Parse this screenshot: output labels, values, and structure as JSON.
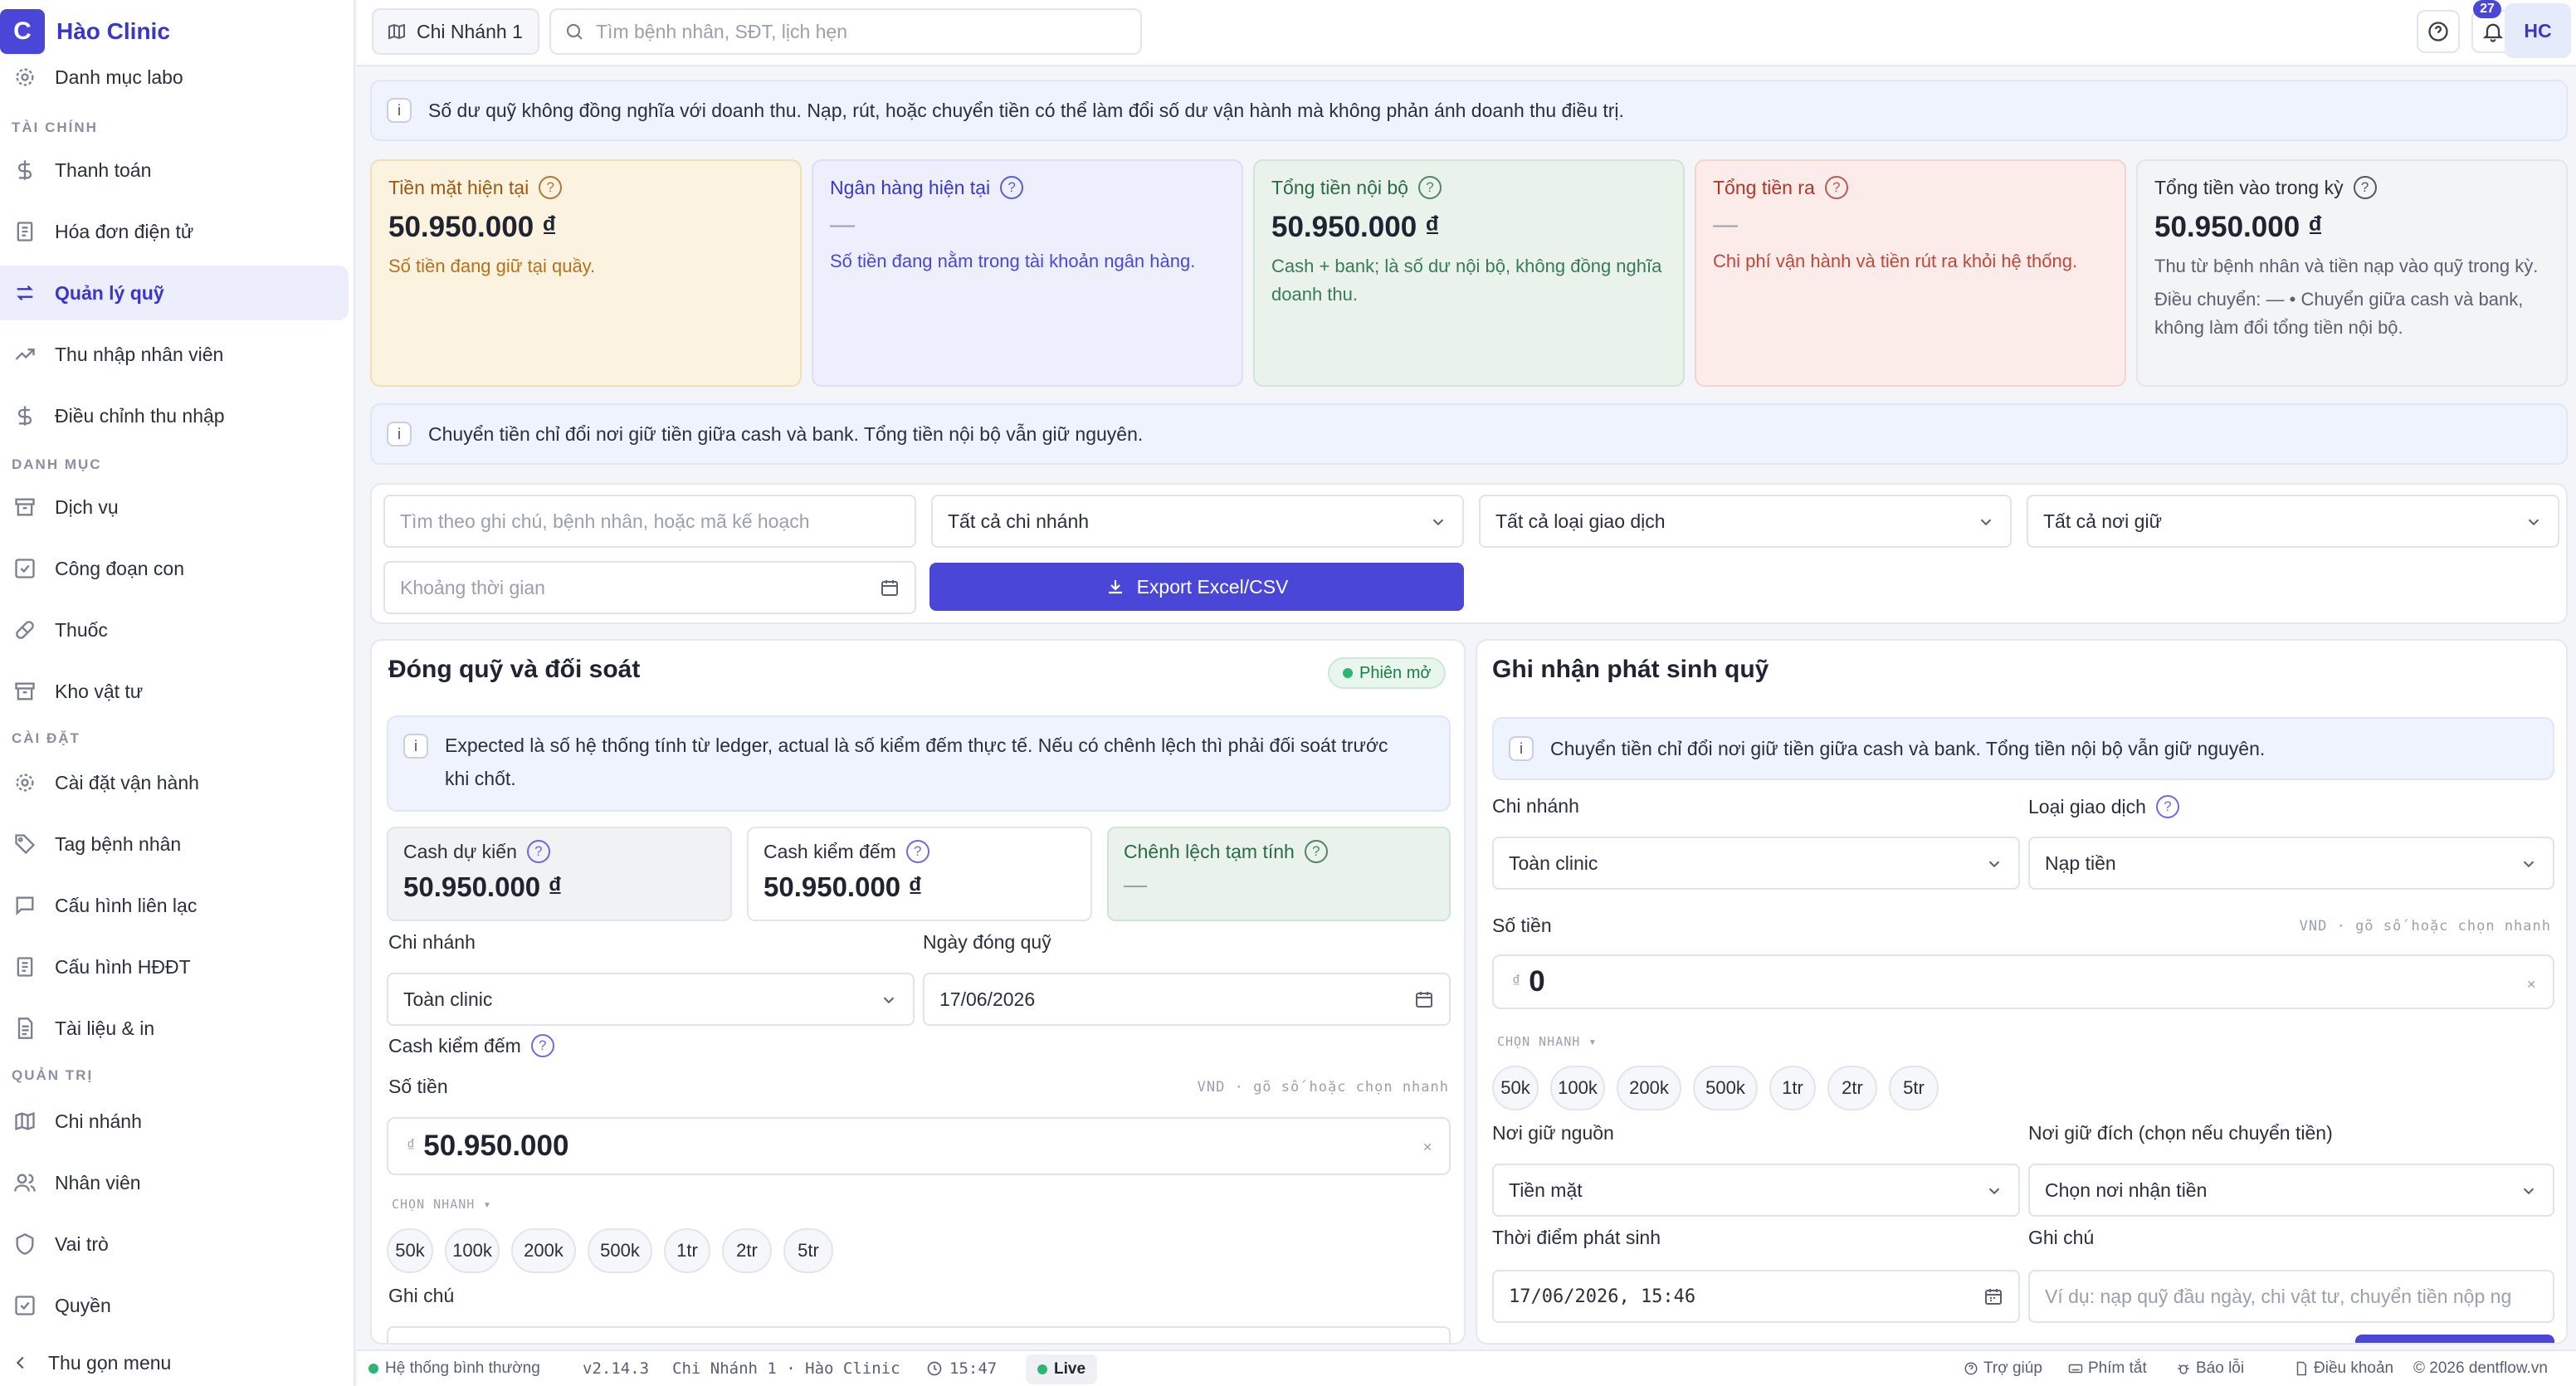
{
  "app": {
    "name": "Hào Clinic",
    "logo_letter": "C",
    "accent": "#4a47d8"
  },
  "sidebar": {
    "top_item": "Danh mục labo",
    "sections": {
      "finance": "TÀI CHÍNH",
      "catalog": "DANH MỤC",
      "settings": "CÀI ĐẶT",
      "admin": "QUẢN TRỊ"
    },
    "items": {
      "payment": "Thanh toán",
      "einvoice": "Hóa đơn điện tử",
      "fund": "Quản lý quỹ",
      "income": "Thu nhập nhân viên",
      "income_adj": "Điều chỉnh thu nhập",
      "services": "Dịch vụ",
      "substeps": "Công đoạn con",
      "medicine": "Thuốc",
      "warehouse": "Kho vật tư",
      "ops_settings": "Cài đặt vận hành",
      "patient_tags": "Tag bệnh nhân",
      "contact_cfg": "Cấu hình liên lạc",
      "einvoice_cfg": "Cấu hình HĐĐT",
      "docs_print": "Tài liệu & in",
      "branches": "Chi nhánh",
      "staff": "Nhân viên",
      "roles": "Vai trò",
      "permissions": "Quyền"
    },
    "collapse": "Thu gọn menu"
  },
  "topbar": {
    "branch": "Chi Nhánh 1",
    "search_placeholder": "Tìm bệnh nhân, SĐT, lịch hẹn",
    "notif_count": "27",
    "avatar": "HC"
  },
  "banner_top": "Số dư quỹ không đồng nghĩa với doanh thu. Nạp, rút, hoặc chuyển tiền có thể làm đổi số dư vận hành mà không phản ánh doanh thu điều trị.",
  "cards": [
    {
      "title": "Tiền mặt hiện tại",
      "value": "50.950.000 ₫",
      "desc": "Số tiền đang giữ tại quầy."
    },
    {
      "title": "Ngân hàng hiện tại",
      "value": "—",
      "desc": "Số tiền đang nằm trong tài khoản ngân hàng."
    },
    {
      "title": "Tổng tiền nội bộ",
      "value": "50.950.000 ₫",
      "desc": "Cash + bank; là số dư nội bộ, không đồng nghĩa doanh thu."
    },
    {
      "title": "Tổng tiền ra",
      "value": "—",
      "desc": "Chi phí vận hành và tiền rút ra khỏi hệ thống."
    },
    {
      "title": "Tổng tiền vào trong kỳ",
      "value": "50.950.000 ₫",
      "desc": "Thu từ bệnh nhân và tiền nạp vào quỹ trong kỳ.",
      "desc2": "Điều chuyển: — • Chuyển giữa cash và bank, không làm đổi tổng tiền nội bộ."
    }
  ],
  "banner_mid": "Chuyển tiền chỉ đổi nơi giữ tiền giữa cash và bank. Tổng tiền nội bộ vẫn giữ nguyên.",
  "filters": {
    "search_placeholder": "Tìm theo ghi chú, bệnh nhân, hoặc mã kế hoạch",
    "branch": "Tất cả chi nhánh",
    "type": "Tất cả loại giao dịch",
    "holder": "Tất cả nơi giữ",
    "date_placeholder": "Khoảng thời gian",
    "export": "Export Excel/CSV"
  },
  "close_panel": {
    "title": "Đóng quỹ và đối soát",
    "status": "Phiên mở",
    "info": "Expected là số hệ thống tính từ ledger, actual là số kiểm đếm thực tế. Nếu có chênh lệch thì phải đối soát trước khi chốt.",
    "expected_label": "Cash dự kiến",
    "expected_value": "50.950.000 ₫",
    "counted_label": "Cash kiểm đếm",
    "counted_value": "50.950.000 ₫",
    "diff_label": "Chênh lệch tạm tính",
    "diff_value": "—",
    "branch_label": "Chi nhánh",
    "branch_value": "Toàn clinic",
    "date_label": "Ngày đóng quỹ",
    "date_value": "17/06/2026",
    "cash_label": "Cash kiểm đếm",
    "amount_label": "Số tiền",
    "amount_hint": "VND · gõ số hoặc chọn nhanh",
    "amount_value": "50.950.000",
    "currency": "₫",
    "quick_label": "CHỌN NHANH ▾",
    "chips": [
      "50k",
      "100k",
      "200k",
      "500k",
      "1tr",
      "2tr",
      "5tr"
    ],
    "note_label": "Ghi chú"
  },
  "record_panel": {
    "title": "Ghi nhận phát sinh quỹ",
    "info": "Chuyển tiền chỉ đổi nơi giữ tiền giữa cash và bank. Tổng tiền nội bộ vẫn giữ nguyên.",
    "branch_label": "Chi nhánh",
    "branch_value": "Toàn clinic",
    "type_label": "Loại giao dịch",
    "type_value": "Nạp tiền",
    "amount_label": "Số tiền",
    "amount_hint": "VND · gõ số hoặc chọn nhanh",
    "amount_value": "0",
    "currency": "₫",
    "quick_label": "CHỌN NHANH ▾",
    "chips": [
      "50k",
      "100k",
      "200k",
      "500k",
      "1tr",
      "2tr",
      "5tr"
    ],
    "source_label": "Nơi giữ nguồn",
    "source_value": "Tiền mặt",
    "dest_label": "Nơi giữ đích (chọn nếu chuyển tiền)",
    "dest_value": "Chọn nơi nhận tiền",
    "time_label": "Thời điểm phát sinh",
    "time_value": "17/06/2026, 15:46",
    "note_label": "Ghi chú",
    "note_placeholder": "Ví dụ: nạp quỹ đầu ngày, chi vật tư, chuyển tiền nộp ng"
  },
  "statusbar": {
    "system": "Hệ thống bình thường",
    "version": "v2.14.3",
    "context": "Chi Nhánh 1 · Hào Clinic",
    "time": "15:47",
    "live": "Live",
    "help": "Trợ giúp",
    "shortcuts": "Phím tắt",
    "report": "Báo lỗi",
    "terms": "Điều khoản",
    "copyright": "© 2026 dentflow.vn"
  }
}
